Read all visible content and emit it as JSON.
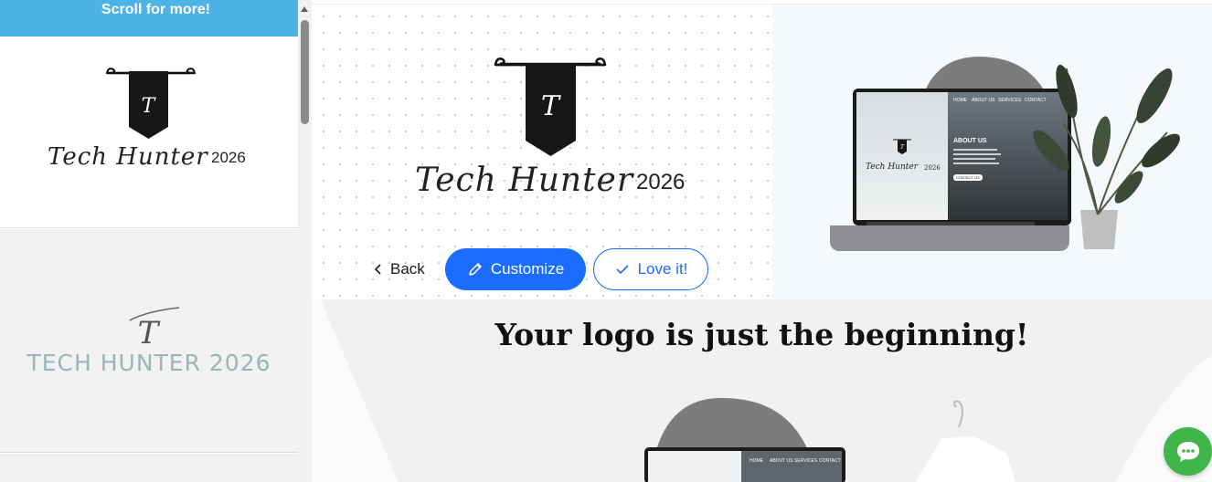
{
  "sidebar": {
    "banner": "Scroll for more!",
    "logos": [
      {
        "name": "Tech Hunter",
        "year": "2026",
        "monogram": "T"
      },
      {
        "text": "TECH HUNTER 2026",
        "monogram": "T"
      }
    ]
  },
  "preview": {
    "logo_name": "Tech Hunter",
    "logo_year": "2026",
    "monogram": "T"
  },
  "actions": {
    "back": "Back",
    "customize": "Customize",
    "love": "Love it!"
  },
  "mockup": {
    "nav": [
      "HOME",
      "ABOUT US",
      "SERVICES",
      "CONTACT"
    ],
    "about": "ABOUT US",
    "cta": "CONTACT US",
    "logo_name": "Tech Hunter",
    "logo_year": "2026",
    "monogram": "T"
  },
  "bottom": {
    "headline": "Your logo is just the beginning!",
    "nav": [
      "HOME",
      "ABOUT US",
      "SERVICES",
      "CONTACT"
    ]
  },
  "colors": {
    "accent": "#1a6dff",
    "banner": "#4db3e6",
    "chat": "#3fb54a"
  },
  "icons": {
    "back": "chevron-left-icon",
    "customize": "pencil-icon",
    "love": "check-icon",
    "chat": "chat-bubble-icon"
  }
}
